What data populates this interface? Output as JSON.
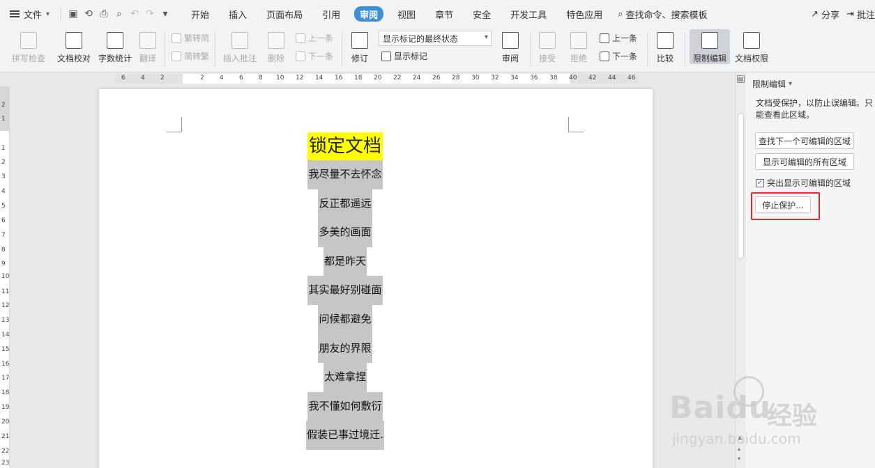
{
  "menubar": {
    "file_label": "文件",
    "tabs": [
      "开始",
      "插入",
      "页面布局",
      "引用",
      "审阅",
      "视图",
      "章节",
      "安全",
      "开发工具",
      "特色应用"
    ],
    "active_tab": "审阅",
    "search_label": "查找命令、搜索模板",
    "share_label": "分享",
    "comment_label": "批注"
  },
  "ribbon": {
    "spell_check": "拼写检查",
    "doc_proof": "文档校对",
    "word_count": "字数统计",
    "translate": "翻译",
    "trad_conv": "繁转简",
    "simp_conv": "简转繁",
    "insert_comment": "插入批注",
    "delete": "删除",
    "prev_comment": "上一条",
    "next_comment": "下一条",
    "track": "修订",
    "markup_state": "显示标记的最终状态",
    "show_markup": "显示标记",
    "review": "审阅",
    "accept": "接受",
    "reject": "拒绝",
    "prev_change": "上一条",
    "next_change": "下一条",
    "compare": "比较",
    "restrict_edit": "限制编辑",
    "doc_permission": "文档权限"
  },
  "ruler": {
    "h_ticks": [
      "6",
      "4",
      "2",
      "2",
      "4",
      "6",
      "8",
      "10",
      "12",
      "14",
      "16",
      "18",
      "20",
      "22",
      "24",
      "26",
      "28",
      "30",
      "32",
      "34",
      "36",
      "38",
      "40",
      "42",
      "44",
      "46"
    ],
    "v_ticks": [
      "2",
      "1",
      "1",
      "2",
      "3",
      "4",
      "5",
      "6",
      "7",
      "8",
      "9",
      "10",
      "11",
      "12",
      "13",
      "14",
      "15",
      "16",
      "17",
      "18",
      "19",
      "20",
      "21",
      "22",
      "23"
    ]
  },
  "document": {
    "title": "锁定文档",
    "lines": [
      "我尽量不去怀念",
      "反正都遥远",
      "多美的画面",
      "都是昨天",
      "其实最好别碰面",
      "问候都避免",
      "朋友的界限",
      "太难拿捏",
      "我不懂如何敷衍",
      "假装已事过境迁."
    ]
  },
  "panel": {
    "title": "限制编辑",
    "description": "文档受保护，以防止误编辑。只能查看此区域。",
    "find_next_btn": "查找下一个可编辑的区域",
    "show_all_btn": "显示可编辑的所有区域",
    "highlight_label": "突出显示可编辑的区域",
    "highlight_checked": true,
    "stop_protect_btn": "停止保护..."
  },
  "watermark": {
    "logo": "Baidu",
    "cn": "经验",
    "url": "jingyan.baidu.com"
  },
  "colors": {
    "active_tab": "#3f8fd6",
    "title_highlight": "#ffff00",
    "line_shading": "#c6c6c6",
    "callout_border": "#e8262c"
  }
}
